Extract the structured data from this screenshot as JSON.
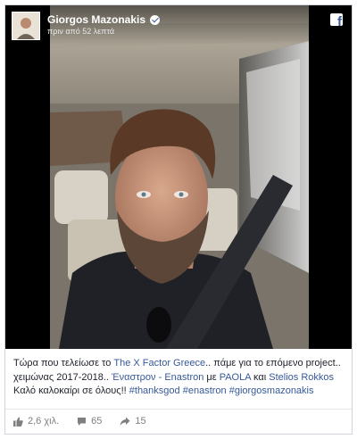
{
  "post": {
    "author": "Giorgos Mazonakis",
    "timestamp": "πριν από 52 λεπτά",
    "verified_icon": "verified-badge-icon",
    "platform_icon": "facebook-logo-icon"
  },
  "caption": {
    "t1": "Τώρα που τελείωσε το ",
    "link1": "The X Factor Greece",
    "t2": ".. πάμε για το επόμενο project.. χειμώνας 2017-2018.. ",
    "link2": "Έναστρον - Enastron",
    "t3": " με ",
    "link3": "PAOLA",
    "t4": " και ",
    "link4": "Stelios Rokkos",
    "t5": " Καλό καλοκαίρι σε όλους!! ",
    "tag1": "#thanksgod",
    "tag2": "#enastron",
    "tag3": "#giorgosmazonakis"
  },
  "stats": {
    "likes": "2,6 χιλ.",
    "comments": "65",
    "shares": "15"
  },
  "colors": {
    "link": "#365899",
    "text": "#1d2129",
    "muted": "#7f7f7f"
  }
}
